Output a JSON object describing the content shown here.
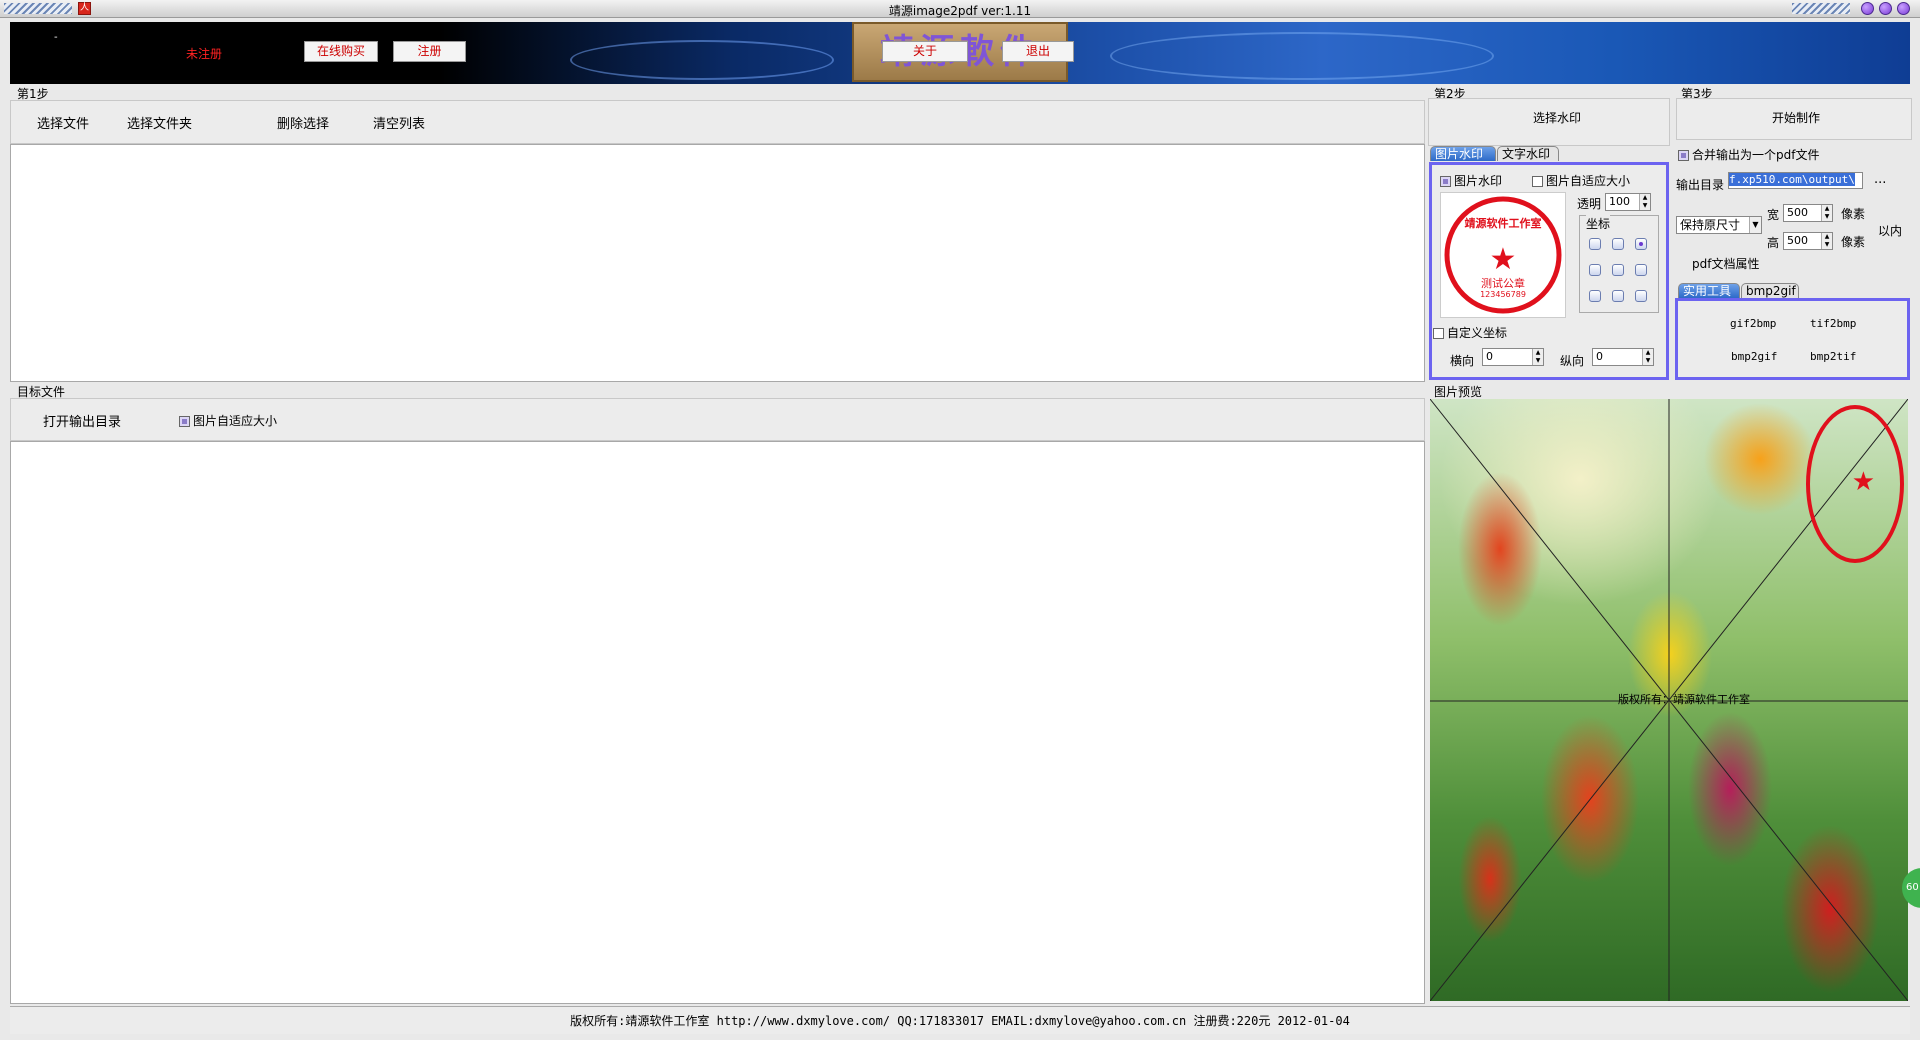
{
  "window": {
    "title": "靖源image2pdf ver:1.11",
    "app_icon_glyph": "人"
  },
  "banner": {
    "dot": "-",
    "unregistered": "未注册",
    "buy_online": "在线购买",
    "register": "注册",
    "logo_text": "靖源軟件",
    "about": "关于",
    "exit": "退出"
  },
  "step1": {
    "label": "第1步",
    "select_files": "选择文件",
    "select_folder": "选择文件夹",
    "delete_selected": "删除选择",
    "clear_list": "清空列表"
  },
  "target": {
    "label": "目标文件",
    "open_output": "打开输出目录",
    "auto_fit": "图片自适应大小",
    "auto_fit_checked": true
  },
  "step2": {
    "label": "第2步",
    "select_watermark": "选择水印",
    "tabs": [
      {
        "label": "图片水印",
        "active": true
      },
      {
        "label": "文字水印",
        "active": false
      }
    ],
    "image_watermark": "图片水印",
    "image_watermark_checked": true,
    "image_autofit": "图片自适应大小",
    "image_autofit_checked": false,
    "opacity_label": "透明",
    "opacity_value": "100",
    "coord_label": "坐标",
    "custom_coord": "自定义坐标",
    "horizontal_label": "横向",
    "horizontal_value": "0",
    "vertical_label": "纵向",
    "vertical_value": "0",
    "stamp": {
      "top_text": "靖源软件工作室",
      "bottom_text": "测试公章",
      "number": "123456789"
    }
  },
  "step3": {
    "label": "第3步",
    "start": "开始制作",
    "merge_output": "合并输出为一个pdf文件",
    "merge_checked": true,
    "output_dir_label": "输出目录",
    "output_dir_value": "f.xp510.com\\output\\",
    "browse": "...",
    "size_mode": "保持原尺寸",
    "width_label": "宽",
    "width_value": "500",
    "height_label": "高",
    "height_value": "500",
    "pixel_unit": "像素",
    "within": "以内",
    "pdf_props": "pdf文档属性",
    "tool_tabs": [
      {
        "label": "实用工具",
        "active": true
      },
      {
        "label": "bmp2gif",
        "active": false
      }
    ],
    "tools": [
      "gif2bmp",
      "tif2bmp",
      "bmp2gif",
      "bmp2tif"
    ]
  },
  "preview": {
    "label": "图片预览",
    "overlay_text": "版权所有：靖源软件工作室",
    "badge": "60"
  },
  "status": {
    "text": "版权所有:靖源软件工作室 http://www.dxmylove.com/ QQ:171833017 EMAIL:dxmylove@yahoo.com.cn 注册费:220元 2012-01-04"
  },
  "colors": {
    "accent_purple": "#6c63f0",
    "tab_blue": "#2d6ac8",
    "stamp_red": "#e0101c",
    "unregistered_red": "#ff2222"
  }
}
